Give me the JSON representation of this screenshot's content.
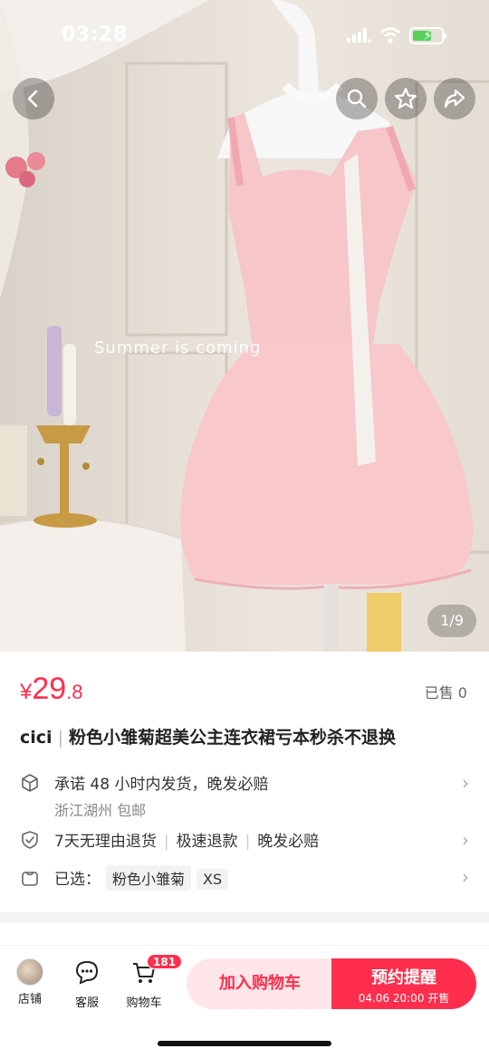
{
  "status_bar": {
    "time": "03:28"
  },
  "hero": {
    "overlay_text": "Summer is coming",
    "page_indicator": "1/9"
  },
  "nav_icons": [
    "back-icon",
    "search-icon",
    "star-icon",
    "share-icon"
  ],
  "price": {
    "currency": "¥",
    "integer": "29",
    "decimal": ".8",
    "color": "#ff2e4c"
  },
  "sold": "已售 0",
  "product": {
    "shop_name": "cici",
    "separator": "|",
    "title": "粉色小雏菊超美公主连衣裙亏本秒杀不退换"
  },
  "info": {
    "shipping": {
      "promise": "承诺 48 小时内发货，晚发必赔",
      "origin": "浙江湖州 包邮"
    },
    "guarantees": [
      "7天无理由退货",
      "极速退款",
      "晚发必赔"
    ],
    "selected": {
      "label": "已选：",
      "color": "粉色小雏菊",
      "size": "XS"
    }
  },
  "bottom_bar": {
    "shop_label": "店铺",
    "service_label": "客服",
    "cart_label": "购物车",
    "cart_badge": "181",
    "add_to_cart": "加入购物车",
    "remind_title": "预约提醒",
    "remind_time": "04.06 20:00 开售"
  }
}
